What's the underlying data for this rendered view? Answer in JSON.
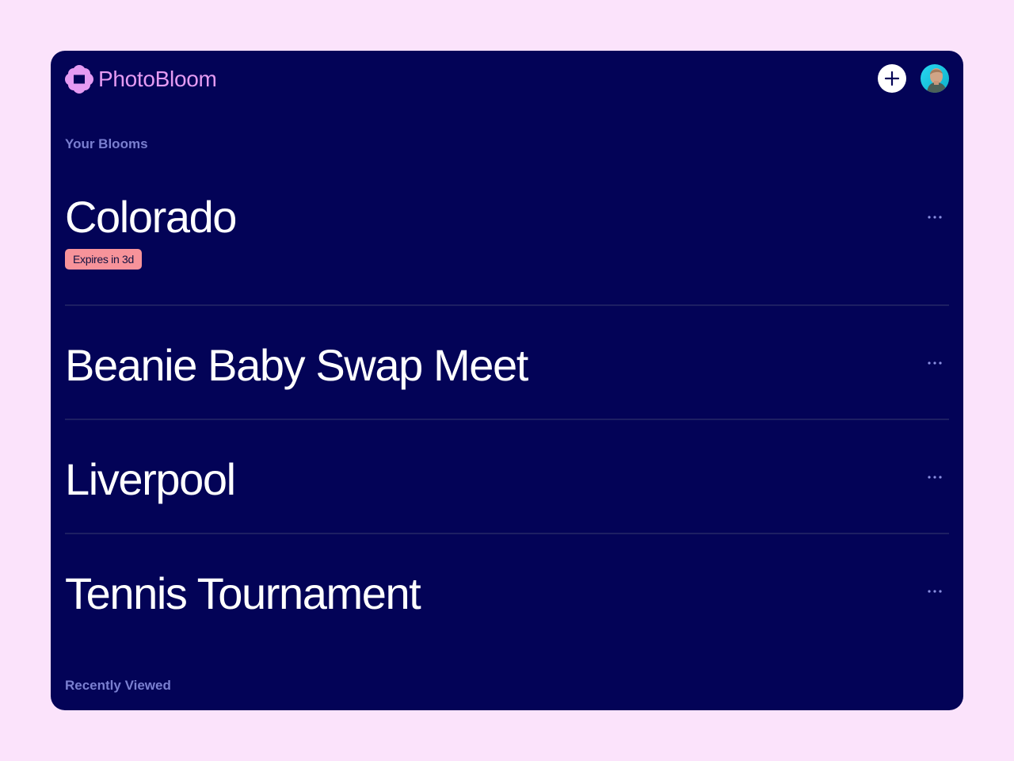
{
  "brand": {
    "name": "PhotoBloom",
    "logo_icon": "flower-logo-icon",
    "accent_color": "#e59bf2"
  },
  "header": {
    "add_button_icon": "plus-icon",
    "avatar_icon": "user-avatar"
  },
  "sections": {
    "your_blooms": "Your Blooms",
    "recently_viewed": "Recently Viewed"
  },
  "blooms": [
    {
      "title": "Colorado",
      "badge": "Expires in 3d",
      "menu_icon": "more-horizontal-icon"
    },
    {
      "title": "Beanie Baby Swap Meet",
      "menu_icon": "more-horizontal-icon"
    },
    {
      "title": "Liverpool",
      "menu_icon": "more-horizontal-icon"
    },
    {
      "title": "Tennis Tournament",
      "menu_icon": "more-horizontal-icon"
    }
  ],
  "colors": {
    "page_background": "#fbe3fb",
    "panel_background": "#030357",
    "section_label": "#7a7fd0",
    "badge_background": "#f7939a",
    "divider": "#1d1f63"
  }
}
